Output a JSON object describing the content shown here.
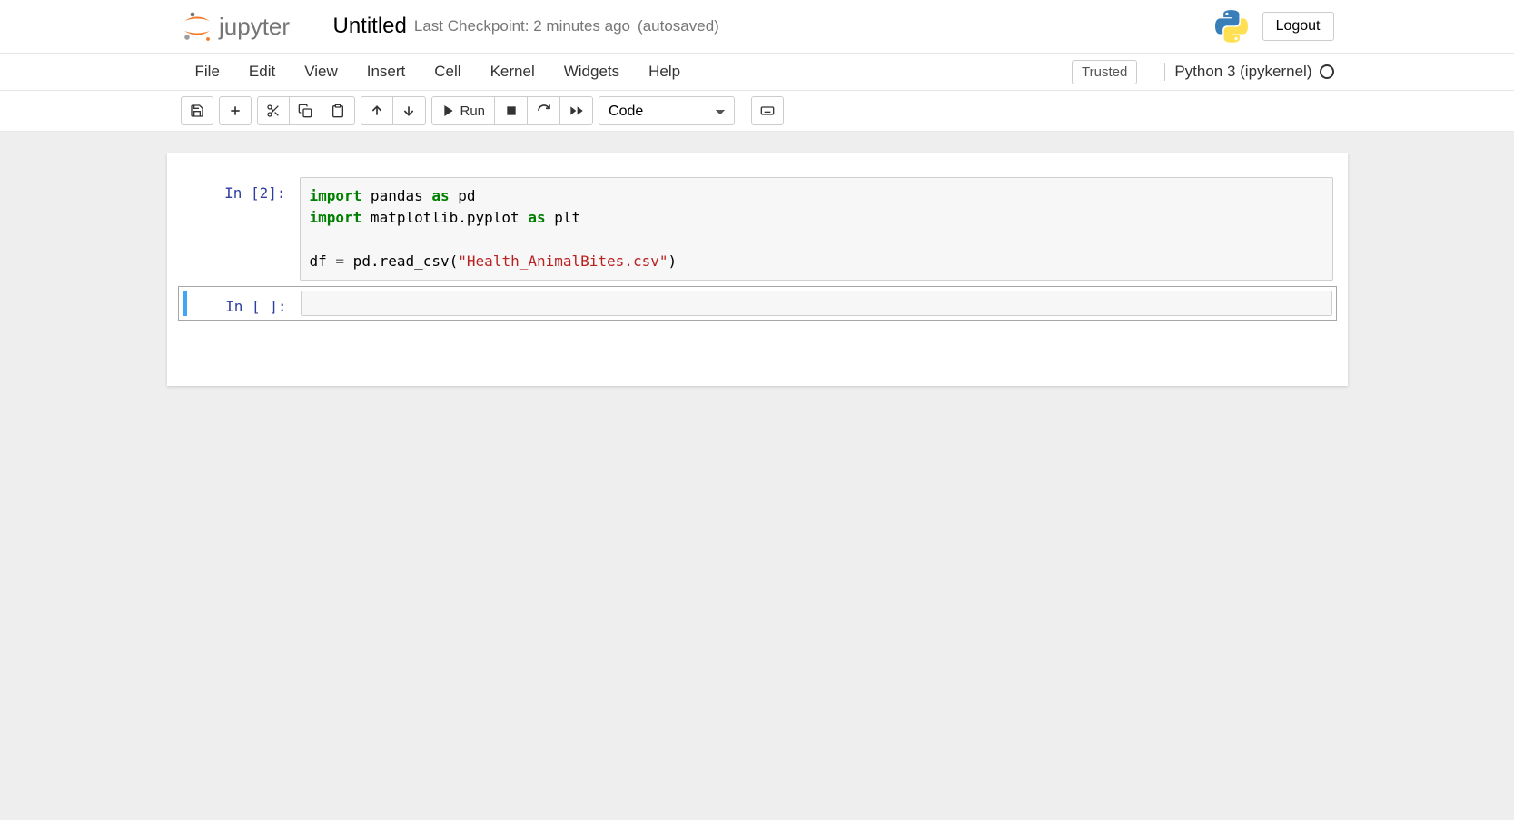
{
  "header": {
    "notebook_name": "Untitled",
    "checkpoint_status": "Last Checkpoint: 2 minutes ago",
    "autosave_status": "(autosaved)",
    "logout_label": "Logout"
  },
  "menubar": {
    "items": [
      "File",
      "Edit",
      "View",
      "Insert",
      "Cell",
      "Kernel",
      "Widgets",
      "Help"
    ],
    "trusted_label": "Trusted",
    "kernel_name": "Python 3 (ipykernel)"
  },
  "toolbar": {
    "run_label": "Run",
    "cell_type": "Code"
  },
  "cells": [
    {
      "prompt": "In [2]:",
      "code_tokens": [
        {
          "t": "import",
          "c": "keyword"
        },
        {
          "t": " pandas ",
          "c": "variable"
        },
        {
          "t": "as",
          "c": "keyword"
        },
        {
          "t": " pd",
          "c": "variable"
        },
        {
          "t": "\n",
          "c": "nl"
        },
        {
          "t": "import",
          "c": "keyword"
        },
        {
          "t": " matplotlib.pyplot ",
          "c": "variable"
        },
        {
          "t": "as",
          "c": "keyword"
        },
        {
          "t": " plt",
          "c": "variable"
        },
        {
          "t": "\n",
          "c": "nl"
        },
        {
          "t": "\n",
          "c": "nl"
        },
        {
          "t": "df ",
          "c": "variable"
        },
        {
          "t": "=",
          "c": "op"
        },
        {
          "t": " pd.read_csv(",
          "c": "variable"
        },
        {
          "t": "\"Health_AnimalBites.csv\"",
          "c": "string"
        },
        {
          "t": ")",
          "c": "variable"
        }
      ],
      "selected": false
    },
    {
      "prompt": "In [ ]:",
      "code_tokens": [],
      "selected": true
    }
  ]
}
